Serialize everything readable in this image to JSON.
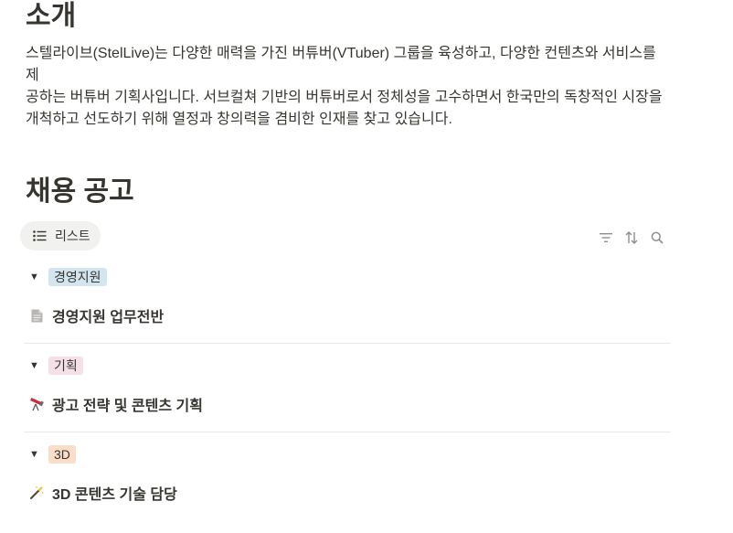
{
  "intro": {
    "title": "소개",
    "line1": "스텔라이브(StelLive)는 다양한 매력을 가진 버튜버(VTuber) 그룹을 육성하고, 다양한 컨텐츠와 서비스를 제",
    "line2": "공하는 버튜버 기획사입니다. 서브컬쳐 기반의 버튜버로서 정체성을 고수하면서 한국만의 독창적인 시장을",
    "line3": "개척하고 선도하기 위해 열정과 창의력을 겸비한 인재를 찾고 있습니다."
  },
  "jobs": {
    "title": "채용 공고",
    "view_label": "리스트",
    "groups": [
      {
        "tag": "경영지원",
        "tag_color": "#d3e5ef",
        "item": "경영지원 업무전반",
        "icon": "page-icon"
      },
      {
        "tag": "기획",
        "tag_color": "#f5e0e9",
        "item": "광고 전략 및 콘텐츠 기획",
        "icon": "telescope-icon"
      },
      {
        "tag": "3D",
        "tag_color": "#fadec9",
        "item": "3D 콘텐츠 기술 담당",
        "icon": "magic-wand-icon"
      }
    ]
  }
}
